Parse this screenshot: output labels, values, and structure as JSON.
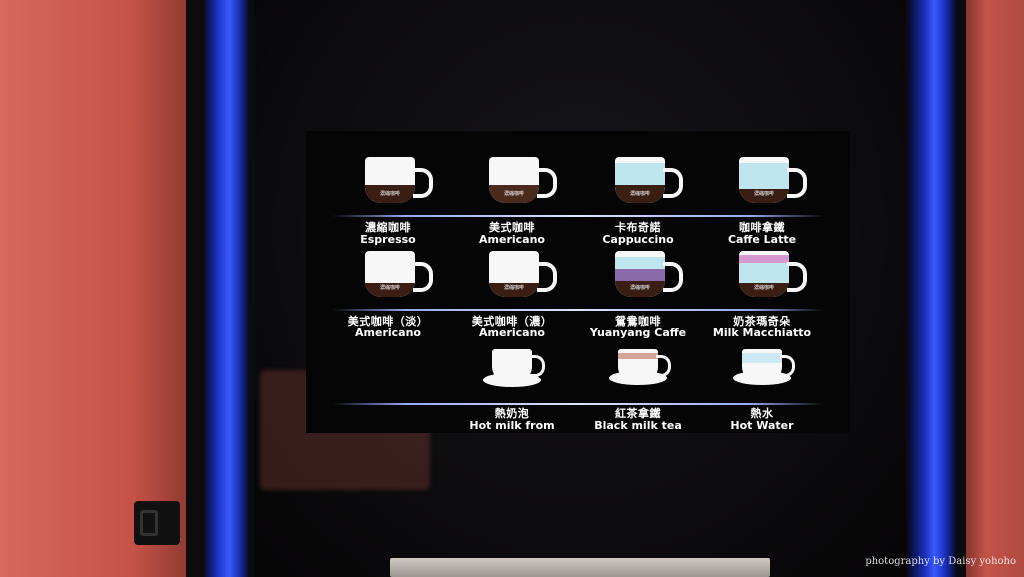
{
  "menu": {
    "row1": [
      {
        "zh": "濃縮咖啡",
        "en": "Espresso",
        "cup_label": "濃縮咖啡"
      },
      {
        "zh": "美式咖啡",
        "en": "Americano",
        "cup_label": "濃縮咖啡"
      },
      {
        "zh": "卡布奇諾",
        "en": "Cappuccino",
        "cup_label": "濃縮咖啡"
      },
      {
        "zh": "咖啡拿鐵",
        "en": "Caffe  Latte",
        "cup_label": "濃縮咖啡"
      }
    ],
    "row2": [
      {
        "zh": "美式咖啡（淡）",
        "en": "Americano",
        "cup_label": "濃縮咖啡"
      },
      {
        "zh": "美式咖啡（濃）",
        "en": "Americano",
        "cup_label": "濃縮咖啡"
      },
      {
        "zh": "鴛鴦咖啡",
        "en": "Yuanyang Caffe",
        "cup_label": "濃縮咖啡"
      },
      {
        "zh": "奶茶瑪奇朵",
        "en": "Milk Macchiatto",
        "cup_label": "濃縮咖啡"
      }
    ],
    "row3": [
      {
        "zh": "熱奶泡",
        "en": "Hot milk from"
      },
      {
        "zh": "紅茶拿鐵",
        "en": "Black milk tea"
      },
      {
        "zh": "熱水",
        "en": "Hot Water"
      }
    ]
  },
  "watermark": "photography by Daisy yohoho",
  "colors": {
    "screen_bg": "#050505",
    "cup": "#f7f7f7",
    "espresso": "#3a1e14",
    "milk_blue": "#bfe6ee",
    "yuanyang_purple": "#8a6aa8",
    "macchiato_pink": "#d79ad0",
    "wall": "#c9574a",
    "frame_blue": "#2c48f0"
  }
}
